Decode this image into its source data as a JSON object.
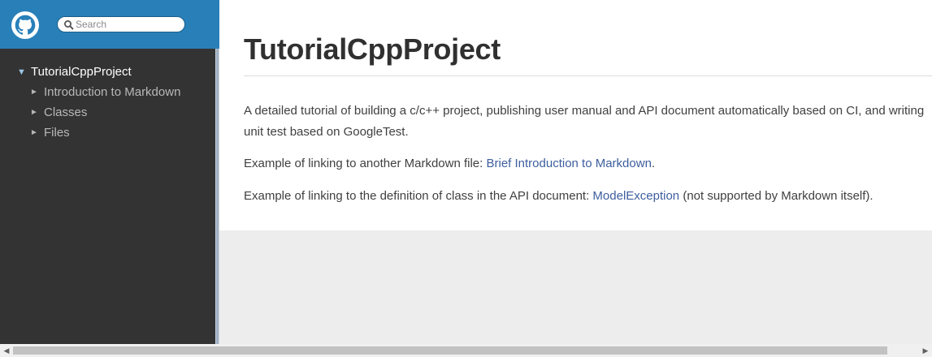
{
  "sidebar": {
    "search": {
      "placeholder": "Search"
    },
    "tree": {
      "root": {
        "arrow": "▼",
        "label": "TutorialCppProject"
      },
      "children": [
        {
          "arrow": "►",
          "label": "Introduction to Markdown"
        },
        {
          "arrow": "►",
          "label": "Classes"
        },
        {
          "arrow": "►",
          "label": "Files"
        }
      ]
    }
  },
  "main": {
    "title": "TutorialCppProject",
    "para1": "A detailed tutorial of building a c/c++ project, publishing user manual and API document automatically based on CI, and writing unit test based on GoogleTest.",
    "para2": {
      "prefix": "Example of linking to another Markdown file: ",
      "link": "Brief Introduction to Markdown",
      "suffix": "."
    },
    "para3": {
      "prefix": "Example of linking to the definition of class in the API document: ",
      "link": "ModelException",
      "suffix": " (not supported by Markdown itself)."
    }
  },
  "scrollbar": {
    "left_arrow": "◀",
    "right_arrow": "▶"
  },
  "colors": {
    "header_blue": "#2980b9",
    "sidebar_dark": "#333333",
    "link": "#3d5e9e",
    "page_bg": "#ededed"
  },
  "icons": {
    "logo": "github-logo-icon",
    "search": "search-icon"
  }
}
